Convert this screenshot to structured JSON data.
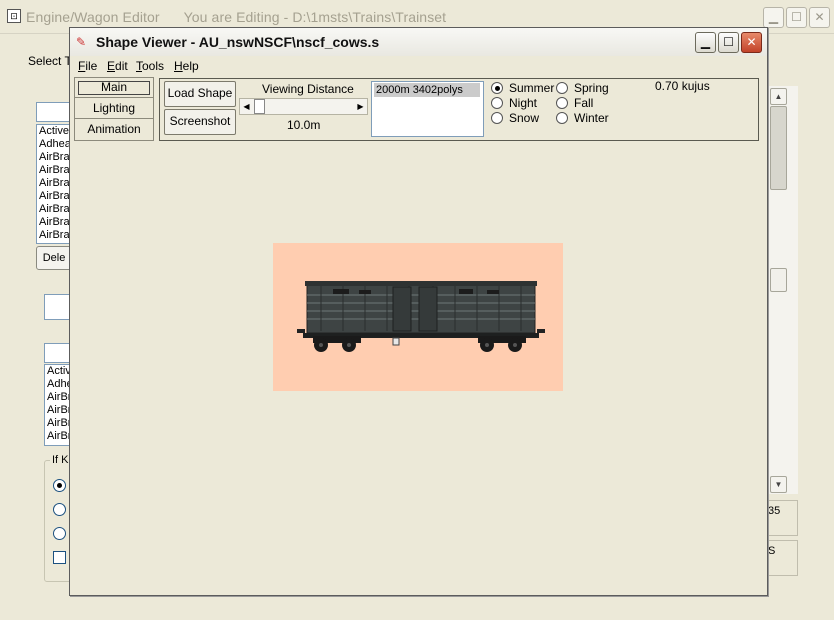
{
  "parent_window": {
    "title": "Engine/Wagon Editor",
    "editing_text": "You are Editing - D:\\1msts\\Trains\\Trainset",
    "select_label": "Select T",
    "list_top": [
      "Active",
      "Adhea",
      "AirBra",
      "AirBra",
      "AirBra",
      "AirBra",
      "AirBra",
      "AirBra",
      "AirBra"
    ],
    "delete_label": "Dele",
    "list_bottom": [
      "Activ",
      "Adhe",
      "AirBr",
      "AirBr",
      "AirBr",
      "AirBr"
    ],
    "group_label": "If K",
    "right_value_1": "35",
    "right_value_2": "S"
  },
  "shape_viewer": {
    "title": "Shape Viewer - AU_nswNSCF\\nscf_cows.s",
    "menu": [
      "File",
      "Edit",
      "Tools",
      "Help"
    ],
    "menu_underline": [
      "F",
      "E",
      "T",
      "H"
    ],
    "tabs": [
      "Main",
      "Lighting",
      "Animation"
    ],
    "load_shape_label": "Load Shape",
    "screenshot_label": "Screenshot",
    "viewing_distance_label": "Viewing Distance",
    "viewing_distance_value": "10.0m",
    "lod_items": [
      "2000m 3402polys"
    ],
    "seasons": [
      {
        "label": "Summer",
        "checked": true
      },
      {
        "label": "Spring",
        "checked": false
      },
      {
        "label": "Night",
        "checked": false
      },
      {
        "label": "Fall",
        "checked": false
      },
      {
        "label": "Snow",
        "checked": false
      },
      {
        "label": "Winter",
        "checked": false
      }
    ],
    "status_readout": "0.70 kujus",
    "preview_background": "#ffcdb0"
  }
}
